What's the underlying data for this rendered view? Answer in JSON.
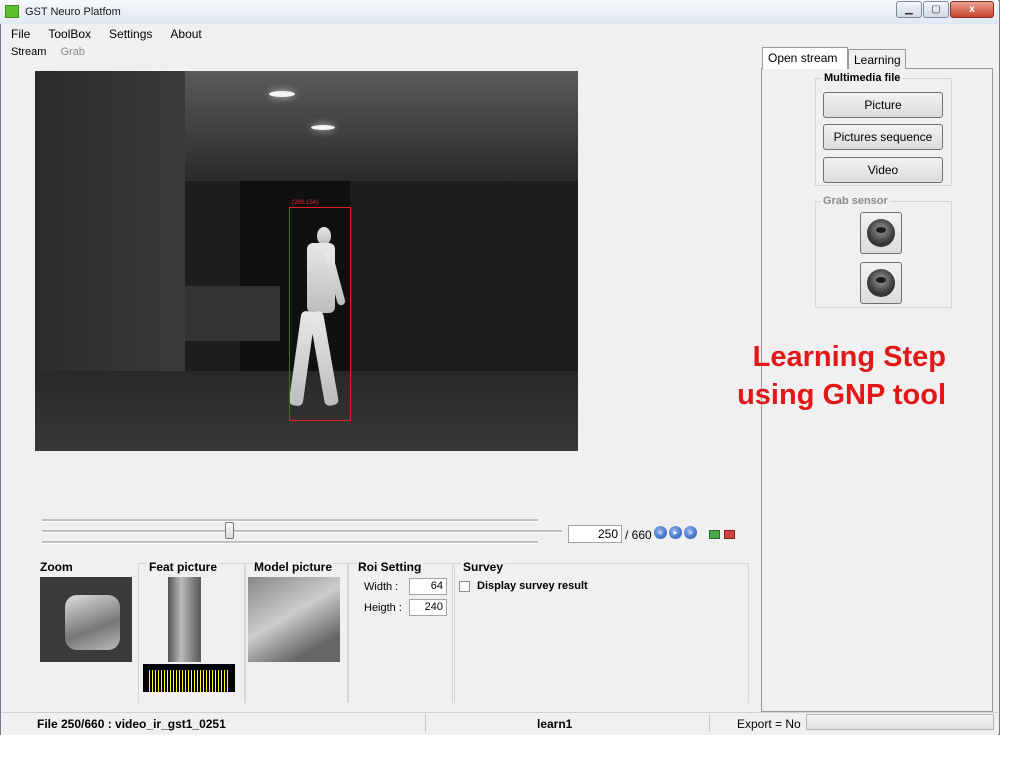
{
  "window": {
    "title": "GST Neuro Platfom",
    "controls": {
      "minimize": "▁",
      "maximize": "▢",
      "close": "x"
    }
  },
  "menu": [
    "File",
    "ToolBox",
    "Settings",
    "About"
  ],
  "toolbar": {
    "stream": "Stream",
    "grab": "Grab"
  },
  "video": {
    "roi_label": "(289-154)"
  },
  "playback": {
    "current_frame": "250",
    "total_frames": "/ 660",
    "position_fraction": 0.378,
    "nav_icons": [
      "previous-icon",
      "play-icon",
      "next-icon"
    ],
    "export_icons": [
      "export-icon",
      "export-all-icon"
    ]
  },
  "panels": {
    "zoom": "Zoom",
    "feat_picture": "Feat picture",
    "model_picture": "Model picture",
    "roi_setting": {
      "title": "Roi Setting",
      "width_label": "Width :",
      "width_value": "64",
      "height_label": "Heigth :",
      "height_value": "240"
    },
    "survey": {
      "title": "Survey",
      "display_label": "Display survey result",
      "checked": false
    }
  },
  "right_panel": {
    "tabs": [
      "Open stream",
      "Learning"
    ],
    "active_tab": "Open stream",
    "multimedia": {
      "title": "Multimedia file",
      "buttons": [
        "Picture",
        "Pictures sequence",
        "Video"
      ]
    },
    "grab_sensor": {
      "title": "Grab sensor",
      "buttons": [
        "camera-icon",
        "camera-play-icon"
      ]
    }
  },
  "annotation": {
    "line1": "Learning  Step",
    "line2": "using GNP tool"
  },
  "status": {
    "file": "File 250/660 : video_ir_gst1_0251",
    "mode": "learn1",
    "export": "Export = No"
  },
  "colors": {
    "annotation_red": "#e01818",
    "roi_red": "#e02020",
    "histogram_yellow": "#ffff00"
  }
}
